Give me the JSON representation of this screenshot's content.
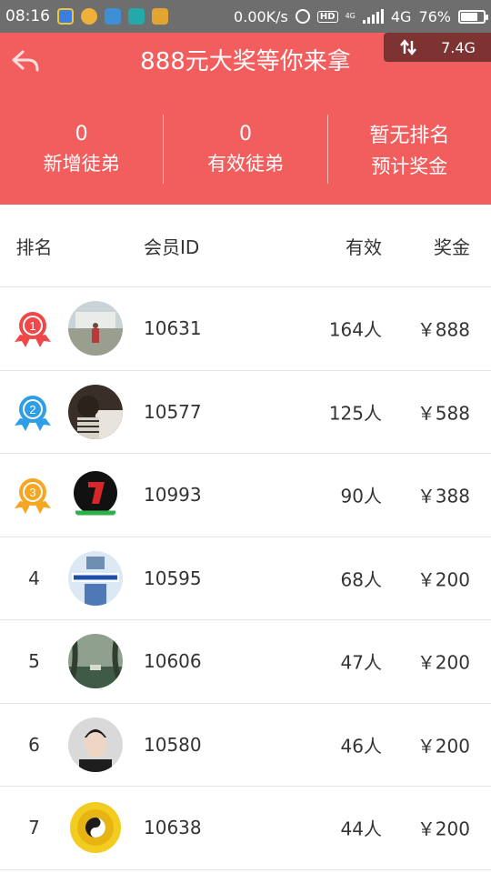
{
  "status_bar": {
    "time": "08:16",
    "net_speed": "0.00K/s",
    "hd": "HD",
    "small_4g": "4G",
    "network": "4G",
    "battery": "76%",
    "battery_level": 0.76
  },
  "header": {
    "title": "888元大奖等你来拿",
    "traffic": "7.4G",
    "stats": [
      {
        "value": "0",
        "label": "新增徒弟"
      },
      {
        "value": "0",
        "label": "有效徒弟"
      },
      {
        "value": "暂无排名",
        "label": "预计奖金"
      }
    ],
    "background": "#f25d5d"
  },
  "table": {
    "headers": {
      "rank": "排名",
      "member_id": "会员ID",
      "valid": "有效",
      "prize": "奖金"
    },
    "rows": [
      {
        "rank": "1",
        "medal": "red",
        "avatar": "avatar-1",
        "member_id": "10631",
        "valid": "164人",
        "prize": "￥888"
      },
      {
        "rank": "2",
        "medal": "blue",
        "avatar": "avatar-2",
        "member_id": "10577",
        "valid": "125人",
        "prize": "￥588"
      },
      {
        "rank": "3",
        "medal": "orange",
        "avatar": "avatar-3",
        "member_id": "10993",
        "valid": "90人",
        "prize": "￥388"
      },
      {
        "rank": "4",
        "medal": "",
        "avatar": "avatar-4",
        "member_id": "10595",
        "valid": "68人",
        "prize": "￥200"
      },
      {
        "rank": "5",
        "medal": "",
        "avatar": "avatar-5",
        "member_id": "10606",
        "valid": "47人",
        "prize": "￥200"
      },
      {
        "rank": "6",
        "medal": "",
        "avatar": "avatar-6",
        "member_id": "10580",
        "valid": "46人",
        "prize": "￥200"
      },
      {
        "rank": "7",
        "medal": "",
        "avatar": "avatar-7",
        "member_id": "10638",
        "valid": "44人",
        "prize": "￥200"
      }
    ]
  },
  "colors": {
    "red_medal": "#f04848",
    "blue_medal": "#2e9ee6",
    "orange_medal": "#f5a623"
  }
}
